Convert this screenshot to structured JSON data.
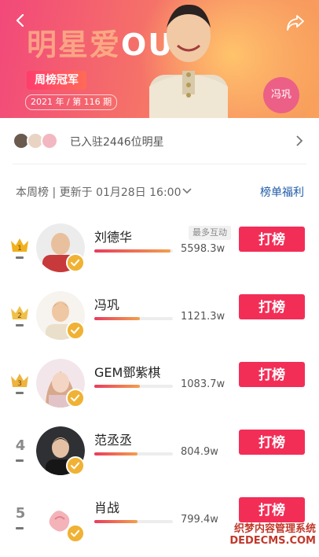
{
  "hero": {
    "title_faded": "明星爱",
    "title_bold": "OU榜",
    "badge": "周榜冠军",
    "week": "2021 年 / 第 116 期",
    "champion_name": "冯巩"
  },
  "stars_entry": {
    "text": "已入驻2446位明星"
  },
  "board": {
    "period": "本周榜 | 更新于 01月28日 16:00",
    "benefit_link": "榜单福利"
  },
  "rows": [
    {
      "rank": "1",
      "name": "刘德华",
      "tag": "最多互动",
      "score": "5598.3w",
      "progress": 0.97,
      "button": "打榜",
      "crown": "gold"
    },
    {
      "rank": "2",
      "name": "冯巩",
      "tag": "",
      "score": "1121.3w",
      "progress": 0.58,
      "button": "打榜",
      "crown": "silver"
    },
    {
      "rank": "3",
      "name": "GEM鄧紫棋",
      "tag": "",
      "score": "1083.7w",
      "progress": 0.58,
      "button": "打榜",
      "crown": "bronze"
    },
    {
      "rank": "4",
      "name": "范丞丞",
      "tag": "",
      "score": "804.9w",
      "progress": 0.55,
      "button": "打榜",
      "crown": ""
    },
    {
      "rank": "5",
      "name": "肖战",
      "tag": "",
      "score": "799.4w",
      "progress": 0.55,
      "button": "打榜",
      "crown": ""
    }
  ],
  "watermark": {
    "line1": "织梦内容管理系统",
    "line2": "DEDECMS.COM"
  }
}
